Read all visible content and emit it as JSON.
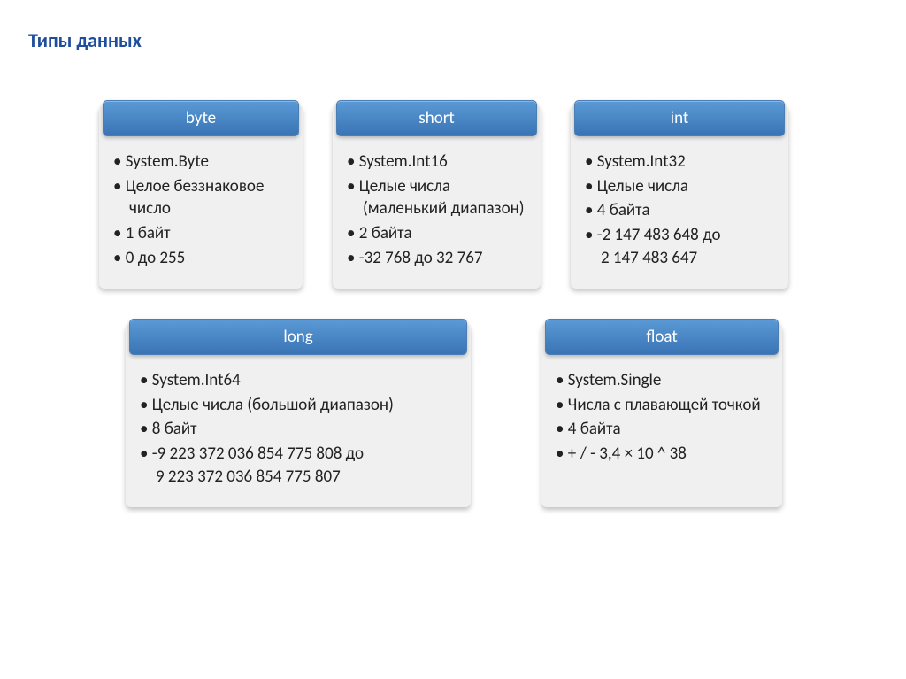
{
  "page_title": "Типы данных",
  "cards": {
    "byte": {
      "title": "byte",
      "items": [
        "System.Byte",
        "Целое беззнаковое число",
        "1 байт",
        "0 до 255"
      ]
    },
    "short": {
      "title": "short",
      "items": [
        "System.Int16",
        "Целые числа (маленький диапазон)",
        "2 байта",
        "-32 768 до 32 767"
      ]
    },
    "int": {
      "title": "int",
      "items": [
        "System.Int32",
        "Целые числа",
        "4 байта",
        "-2 147 483 648 до\n2 147 483 647"
      ]
    },
    "long": {
      "title": "long",
      "items": [
        "System.Int64",
        "Целые числа (большой диапазон)",
        "8 байт",
        "-9 223 372 036 854 775 808 до\n9 223 372 036 854 775 807"
      ]
    },
    "float": {
      "title": "float",
      "items": [
        "System.Single",
        "Числа с плавающей точкой",
        "4 байта",
        "+ / - 3,4 × 10 ^ 38"
      ]
    }
  }
}
